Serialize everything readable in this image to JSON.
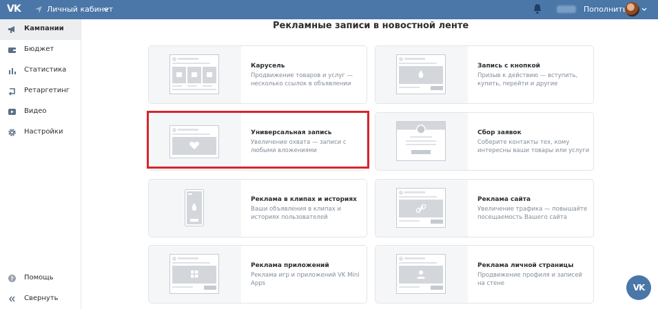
{
  "header": {
    "logo": "VK",
    "cabinet_label": "Личный кабинет",
    "topup_label": "Пополнить"
  },
  "sidebar": {
    "items": [
      {
        "label": "Кампании",
        "icon": "megaphone-icon",
        "active": true
      },
      {
        "label": "Бюджет",
        "icon": "wallet-icon"
      },
      {
        "label": "Статистика",
        "icon": "bar-chart-icon"
      },
      {
        "label": "Ретаргетинг",
        "icon": "retarget-icon"
      },
      {
        "label": "Видео",
        "icon": "video-icon"
      },
      {
        "label": "Настройки",
        "icon": "gear-icon"
      }
    ],
    "bottom": [
      {
        "label": "Помощь",
        "icon": "help-icon"
      },
      {
        "label": "Свернуть",
        "icon": "collapse-icon"
      }
    ]
  },
  "main": {
    "title": "Рекламные записи в новостной ленте",
    "cards": [
      {
        "title": "Карусель",
        "desc": "Продвижение товаров и услуг — несколько ссылок в объявлении"
      },
      {
        "title": "Запись с кнопкой",
        "desc": "Призыв к действию — вступить, купить, перейти и другие"
      },
      {
        "title": "Универсальная запись",
        "desc": "Увеличение охвата — записи с любыми вложениями",
        "highlighted": true
      },
      {
        "title": "Сбор заявок",
        "desc": "Соберите контакты тех, кому интересны ваши товары или услуги"
      },
      {
        "title": "Реклама в клипах и историях",
        "desc": "Ваши объявления в клипах и историях пользователей"
      },
      {
        "title": "Реклама сайта",
        "desc": "Увеличение трафика — повышайте посещаемость Вашего сайта"
      },
      {
        "title": "Реклама приложений",
        "desc": "Реклама игр и приложений VK Mini Apps"
      },
      {
        "title": "Реклама личной страницы",
        "desc": "Продвижение профиля и записей на стене"
      }
    ]
  },
  "fab": {
    "label": "VK"
  },
  "colors": {
    "header": "#4a76a8",
    "highlight": "#d8232a",
    "text_muted": "#818c99"
  }
}
